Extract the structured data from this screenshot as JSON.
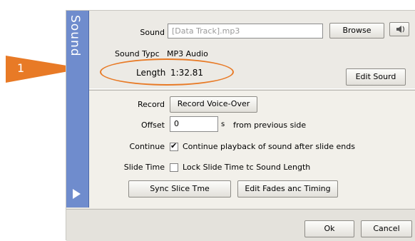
{
  "sidetab": {
    "label": "Sound"
  },
  "callout": {
    "number": "1",
    "color": "#e87a26"
  },
  "sound": {
    "label": "Sound",
    "value": "[Data Track].mp3",
    "browse_label": "Browse",
    "speaker_icon": "speaker-icon"
  },
  "sound_type": {
    "label": "Sound Typc",
    "value": "MP3 Audio"
  },
  "length": {
    "label": "Length",
    "value": "1:32.81"
  },
  "edit_sound_label": "Edit Sourd",
  "record": {
    "label": "Record",
    "button_label": "Record Voice-Over"
  },
  "offset": {
    "label": "Offset",
    "value": "0",
    "unit": "s",
    "suffix": "from previous side"
  },
  "continue": {
    "label": "Continue",
    "checked": true,
    "text": "Continue playback of sound after slide ends"
  },
  "slide_time": {
    "label": "Slide Time",
    "checked": false,
    "text": "Lock Slide Time tc Sound Length"
  },
  "buttons": {
    "sync": "Sync Slice Tme",
    "edit_fades": "Edit Fades anc Timing"
  },
  "footer": {
    "ok": "Ok",
    "cancel": "Cancel"
  },
  "colors": {
    "sidetab": "#6f8ccd",
    "accent": "#e87a26"
  }
}
